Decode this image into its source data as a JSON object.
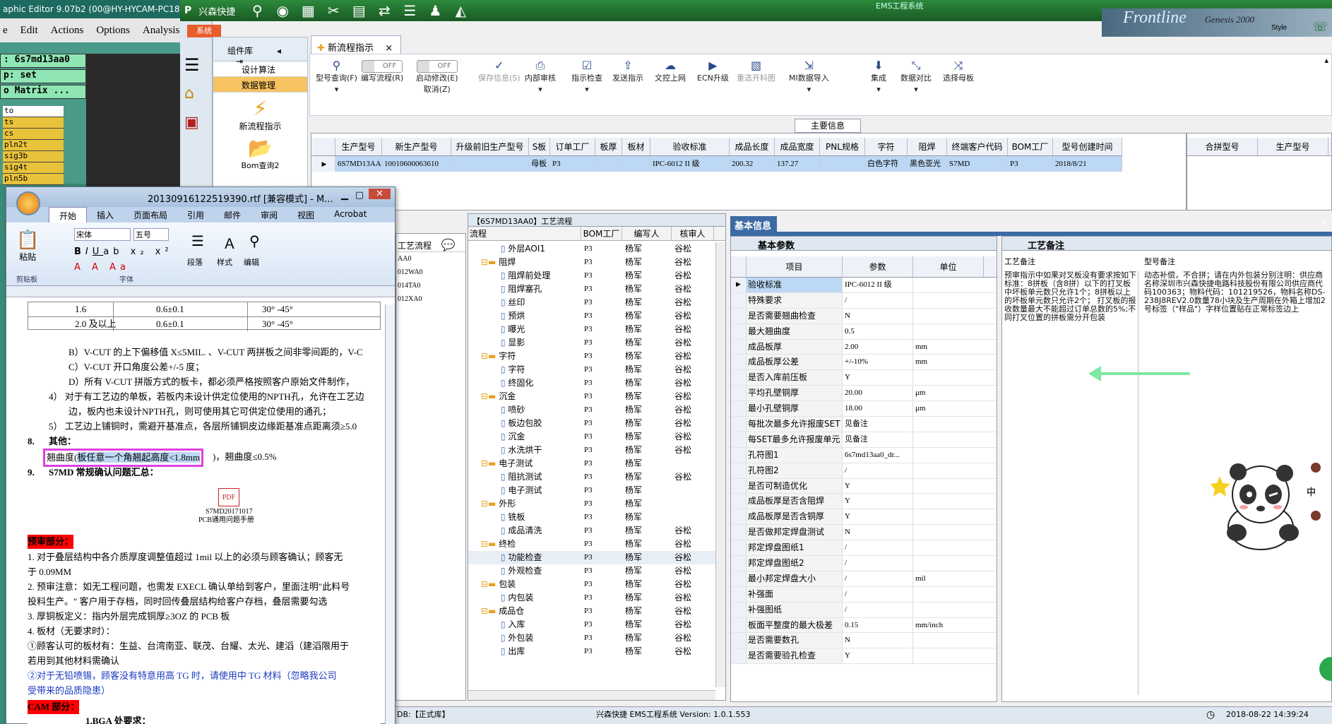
{
  "cam": {
    "title": "aphic Editor 9.07b2 (00@HY-HYCAM-PC18...",
    "menu": [
      "e",
      "Edit",
      "Actions",
      "Options",
      "Analysis"
    ],
    "fields": [
      ": 6s7md13aa0",
      "p: set",
      "o Matrix ..."
    ],
    "layers": [
      "to",
      "ts",
      "cs",
      "pln2t",
      "sig3b",
      "sig4t",
      "pln5b"
    ]
  },
  "ems": {
    "app_name": "兴森快捷",
    "window_title": "EMS工程系统",
    "sys_tab": "系统",
    "frontline_text": "Frontline",
    "genesis_text": "Genesis 2000",
    "style_label": "Style",
    "components": {
      "title": "组件库",
      "items": [
        "设计算法",
        "数据管理"
      ],
      "big": [
        "新流程指示",
        "Bom查询2"
      ]
    },
    "doc_tab": "新流程指示",
    "toolbar": [
      {
        "label": "型号查询(F)",
        "icon": "search-icon"
      },
      {
        "label": "编写流程(R)",
        "toggle": "OFF"
      },
      {
        "label": "启动修改(E)",
        "sub": "取消(Z)",
        "toggle": "OFF"
      },
      {
        "label": "保存信息(S)",
        "icon": "check-icon",
        "disabled": true
      },
      {
        "label": "内部审核",
        "icon": "print-icon"
      },
      {
        "label": "指示检查",
        "icon": "checklist-icon"
      },
      {
        "label": "发送指示",
        "icon": "upload-icon"
      },
      {
        "label": "文控上网",
        "icon": "cloud-icon"
      },
      {
        "label": "ECN升级",
        "icon": "play-icon"
      },
      {
        "label": "重选开料图",
        "icon": "image-icon",
        "disabled": true
      },
      {
        "label": "MI数据导入",
        "icon": "import-icon"
      },
      {
        "label": "集成",
        "icon": "download-icon"
      },
      {
        "label": "数据对比",
        "icon": "compare-icon"
      },
      {
        "label": "选择母板",
        "icon": "shuffle-icon"
      }
    ],
    "main_info_label": "主要信息",
    "main_grid": {
      "headers": [
        "生产型号",
        "新生产型号",
        "升级前旧生产型号",
        "S板",
        "订单工厂",
        "板厚",
        "板材",
        "验收标准",
        "成品长度",
        "成品宽度",
        "PNL规格",
        "字符",
        "阻焊",
        "终端客户代码",
        "BOM工厂",
        "型号创建时间"
      ],
      "row": [
        "6S7MD13AA0",
        "10010600063610",
        "",
        "母板",
        "P3",
        "",
        "",
        "IPC-6012 II 级",
        "200.32",
        "137.27",
        "",
        "白色字符",
        "黑色亚光",
        "S7MD",
        "P3",
        "2018/8/21"
      ]
    },
    "side_grid": {
      "headers": [
        "合拼型号",
        "生产型号"
      ]
    },
    "process": {
      "title": "【6S7MD13AA0】工艺流程",
      "headers": [
        "流程",
        "BOM工厂",
        "编写人",
        "核审人"
      ],
      "left_label": "工艺流程",
      "left_items": [
        "AA0",
        "012WA0",
        "014TA0",
        "012XA0"
      ],
      "rows": [
        {
          "name": "外层AOI1",
          "level": 2,
          "folder": false,
          "bom": "P3",
          "writer": "杨军",
          "reviewer": "谷松"
        },
        {
          "name": "阻焊",
          "level": 1,
          "folder": true,
          "bom": "P3",
          "writer": "杨军",
          "reviewer": "谷松"
        },
        {
          "name": "阻焊前处理",
          "level": 2,
          "folder": false,
          "bom": "P3",
          "writer": "杨军",
          "reviewer": "谷松"
        },
        {
          "name": "阻焊塞孔",
          "level": 2,
          "folder": false,
          "bom": "P3",
          "writer": "杨军",
          "reviewer": "谷松"
        },
        {
          "name": "丝印",
          "level": 2,
          "folder": false,
          "bom": "P3",
          "writer": "杨军",
          "reviewer": "谷松"
        },
        {
          "name": "预烘",
          "level": 2,
          "folder": false,
          "bom": "P3",
          "writer": "杨军",
          "reviewer": "谷松"
        },
        {
          "name": "曝光",
          "level": 2,
          "folder": false,
          "bom": "P3",
          "writer": "杨军",
          "reviewer": "谷松"
        },
        {
          "name": "显影",
          "level": 2,
          "folder": false,
          "bom": "P3",
          "writer": "杨军",
          "reviewer": "谷松"
        },
        {
          "name": "字符",
          "level": 1,
          "folder": true,
          "bom": "P3",
          "writer": "杨军",
          "reviewer": "谷松"
        },
        {
          "name": "字符",
          "level": 2,
          "folder": false,
          "bom": "P3",
          "writer": "杨军",
          "reviewer": "谷松"
        },
        {
          "name": "终固化",
          "level": 2,
          "folder": false,
          "bom": "P3",
          "writer": "杨军",
          "reviewer": "谷松"
        },
        {
          "name": "沉金",
          "level": 1,
          "folder": true,
          "bom": "P3",
          "writer": "杨军",
          "reviewer": "谷松"
        },
        {
          "name": "喷砂",
          "level": 2,
          "folder": false,
          "bom": "P3",
          "writer": "杨军",
          "reviewer": "谷松"
        },
        {
          "name": "板边包胶",
          "level": 2,
          "folder": false,
          "bom": "P3",
          "writer": "杨军",
          "reviewer": "谷松"
        },
        {
          "name": "沉金",
          "level": 2,
          "folder": false,
          "bom": "P3",
          "writer": "杨军",
          "reviewer": "谷松"
        },
        {
          "name": "水洗烘干",
          "level": 2,
          "folder": false,
          "bom": "P3",
          "writer": "杨军",
          "reviewer": "谷松"
        },
        {
          "name": "电子测试",
          "level": 1,
          "folder": true,
          "bom": "P3",
          "writer": "杨军",
          "reviewer": ""
        },
        {
          "name": "阻抗测试",
          "level": 2,
          "folder": false,
          "bom": "P3",
          "writer": "杨军",
          "reviewer": "谷松"
        },
        {
          "name": "电子测试",
          "level": 2,
          "folder": false,
          "bom": "P3",
          "writer": "杨军",
          "reviewer": ""
        },
        {
          "name": "外形",
          "level": 1,
          "folder": true,
          "bom": "P3",
          "writer": "杨军",
          "reviewer": ""
        },
        {
          "name": "铣板",
          "level": 2,
          "folder": false,
          "bom": "P3",
          "writer": "杨军",
          "reviewer": ""
        },
        {
          "name": "成品清洗",
          "level": 2,
          "folder": false,
          "bom": "P3",
          "writer": "杨军",
          "reviewer": "谷松"
        },
        {
          "name": "终检",
          "level": 1,
          "folder": true,
          "bom": "P3",
          "writer": "杨军",
          "reviewer": "谷松"
        },
        {
          "name": "功能检查",
          "level": 2,
          "folder": false,
          "bom": "P3",
          "writer": "杨军",
          "reviewer": "谷松"
        },
        {
          "name": "外观检查",
          "level": 2,
          "folder": false,
          "bom": "P3",
          "writer": "杨军",
          "reviewer": "谷松"
        },
        {
          "name": "包装",
          "level": 1,
          "folder": true,
          "bom": "P3",
          "writer": "杨军",
          "reviewer": "谷松"
        },
        {
          "name": "内包装",
          "level": 2,
          "folder": false,
          "bom": "P3",
          "writer": "杨军",
          "reviewer": "谷松"
        },
        {
          "name": "成品仓",
          "level": 1,
          "folder": true,
          "bom": "P3",
          "writer": "杨军",
          "reviewer": "谷松"
        },
        {
          "name": "入库",
          "level": 2,
          "folder": false,
          "bom": "P3",
          "writer": "杨军",
          "reviewer": "谷松"
        },
        {
          "name": "外包装",
          "level": 2,
          "folder": false,
          "bom": "P3",
          "writer": "杨军",
          "reviewer": "谷松"
        },
        {
          "name": "出库",
          "level": 2,
          "folder": false,
          "bom": "P3",
          "writer": "杨军",
          "reviewer": "谷松"
        }
      ]
    },
    "basic": {
      "tab": "基本信息",
      "sub_tab": "基本参数",
      "headers": [
        "项目",
        "参数",
        "单位"
      ],
      "rows": [
        [
          "验收标准",
          "IPC-6012 II 级",
          ""
        ],
        [
          "特殊要求",
          "/",
          ""
        ],
        [
          "是否需要翘曲检查",
          "N",
          ""
        ],
        [
          "最大翘曲度",
          "0.5",
          ""
        ],
        [
          "成品板厚",
          "2.00",
          "mm"
        ],
        [
          "成品板厚公差",
          "+/-10%",
          "mm"
        ],
        [
          "是否入库前压板",
          "Y",
          ""
        ],
        [
          "平均孔壁铜厚",
          "20.00",
          "μm"
        ],
        [
          "最小孔壁铜厚",
          "18.00",
          "μm"
        ],
        [
          "每批次最多允许报废SET",
          "见备注",
          ""
        ],
        [
          "每SET最多允许报废单元",
          "见备注",
          ""
        ],
        [
          "孔符图1",
          "6s7md13aa0_dr...",
          ""
        ],
        [
          "孔符图2",
          "/",
          ""
        ],
        [
          "是否可制造优化",
          "Y",
          ""
        ],
        [
          "成品板厚是否含阻焊",
          "Y",
          ""
        ],
        [
          "成品板厚是否含铜厚",
          "Y",
          ""
        ],
        [
          "是否做邦定焊盘测试",
          "N",
          ""
        ],
        [
          "邦定焊盘图纸1",
          "/",
          ""
        ],
        [
          "邦定焊盘图纸2",
          "/",
          ""
        ],
        [
          "最小邦定焊盘大小",
          "/",
          "mil"
        ],
        [
          "补强面",
          "/",
          ""
        ],
        [
          "补强图纸",
          "/",
          ""
        ],
        [
          "板面平整度的最大极差",
          "0.15",
          "mm/inch"
        ],
        [
          "是否需要数孔",
          "N",
          ""
        ],
        [
          "是否需要验孔检查",
          "Y",
          ""
        ]
      ]
    },
    "notes": {
      "tab": "工艺备注",
      "craft_header": "工艺备注",
      "type_header": "型号备注",
      "craft_text": "预审指示中如果对叉板没有要求按如下标准：8拼板（含8拼）以下的打叉板中坏板单元数只允许1个；8拼板以上的坏板单元数只允许2个； 打叉板的报收数量最大不能超过订单总数的5%;不同打叉位置的拼板需分开包装",
      "type_text": "动态补偿，不合拼；请在内外包装分别注明：供应商名称深圳市兴森快捷电路科技股份有限公司供应商代码100363；物料代码：101219526，物料名称DS-238J8REV2.0数量78小块及生产周期在外箱上增加2号标签（\"样品\"）字样位置贴在正常标签边上"
    },
    "panda_text": "中",
    "status": {
      "db": "DB:【正式库】",
      "version": "兴森快捷 EMS工程系统 Version: 1.0.1.553",
      "time": "2018-08-22 14:39:24"
    }
  },
  "word": {
    "title": "20130916122519390.rtf [兼容模式] - M...",
    "tabs": [
      "开始",
      "插入",
      "页面布局",
      "引用",
      "邮件",
      "审阅",
      "视图",
      "Acrobat"
    ],
    "font": "宋体",
    "size": "五号",
    "groups": [
      "剪贴板",
      "字体",
      "段落",
      "样式",
      "编辑"
    ],
    "paste": "粘贴",
    "table_rows": [
      [
        "1.6",
        "0.6±0.1",
        "30° -45°"
      ],
      [
        "2.0 及以上",
        "0.6±0.1",
        "30° -45°"
      ]
    ],
    "lines": [
      "B）V-CUT 的上下偏移值 X≤5MIL. 、V-CUT 两拼板之间非零间距的，V-C",
      "C）V-CUT 开口角度公差+/-5 度；",
      "D）所有 V-CUT 拼版方式的板卡，都必须严格按照客户原始文件制作，",
      "4） 对于有工艺边的单板，若板内未设计供定位使用的NPTH孔，允许在工艺边",
      "边，板内也未设计NPTH孔，则可使用其它可供定位使用的通孔；",
      "5） 工艺边上铺铜时，需避开基准点，各层所铺铜皮边缘距基准点距离须≥5.0"
    ],
    "item8": "8.",
    "item8_title": "其他：",
    "warp_prefix": "翘曲度(",
    "warp_highlight": "板任意一个角翘起高度<1.8mm",
    "warp_suffix": ")，翘曲度≤0.5%",
    "item9": "9.",
    "item9_title": "S7MD 常规确认问题汇总：",
    "pdf_name": "S7MD20171017",
    "pdf_sub": "PCB通用问题手册",
    "pre_review": "预审部分：",
    "pre_lines": [
      "1.  对于叠层结构中各介质厚度调整值超过 1mil 以上的必须与顾客确认；顾客无",
      "     于 0.09MM",
      "2.  预审注意：如无工程问题，也需发 EXECL 确认单给到客户，里面注明\"此料号",
      "     投料生产。\"    客户用于存档，同时回传叠层结构给客户存档，叠层需要勾选",
      "3.  厚铜板定义：指内外层完成铜厚≥3OZ 的 PCB 板",
      "4.  板材（无要求时）：",
      "     ①顾客认可的板材有：生益、台湾南亚、联茂、台耀、太光、建滔（建滔限用于",
      "     若用到其他材料需确认",
      "     ②对于无铅喷锡，顾客没有特意用高 TG 时，请使用中 TG 材料（忽略我公司",
      "     受带来的品质隐患）"
    ],
    "cam_part": "CAM 部分：",
    "bga": "1.BGA 处要求："
  }
}
